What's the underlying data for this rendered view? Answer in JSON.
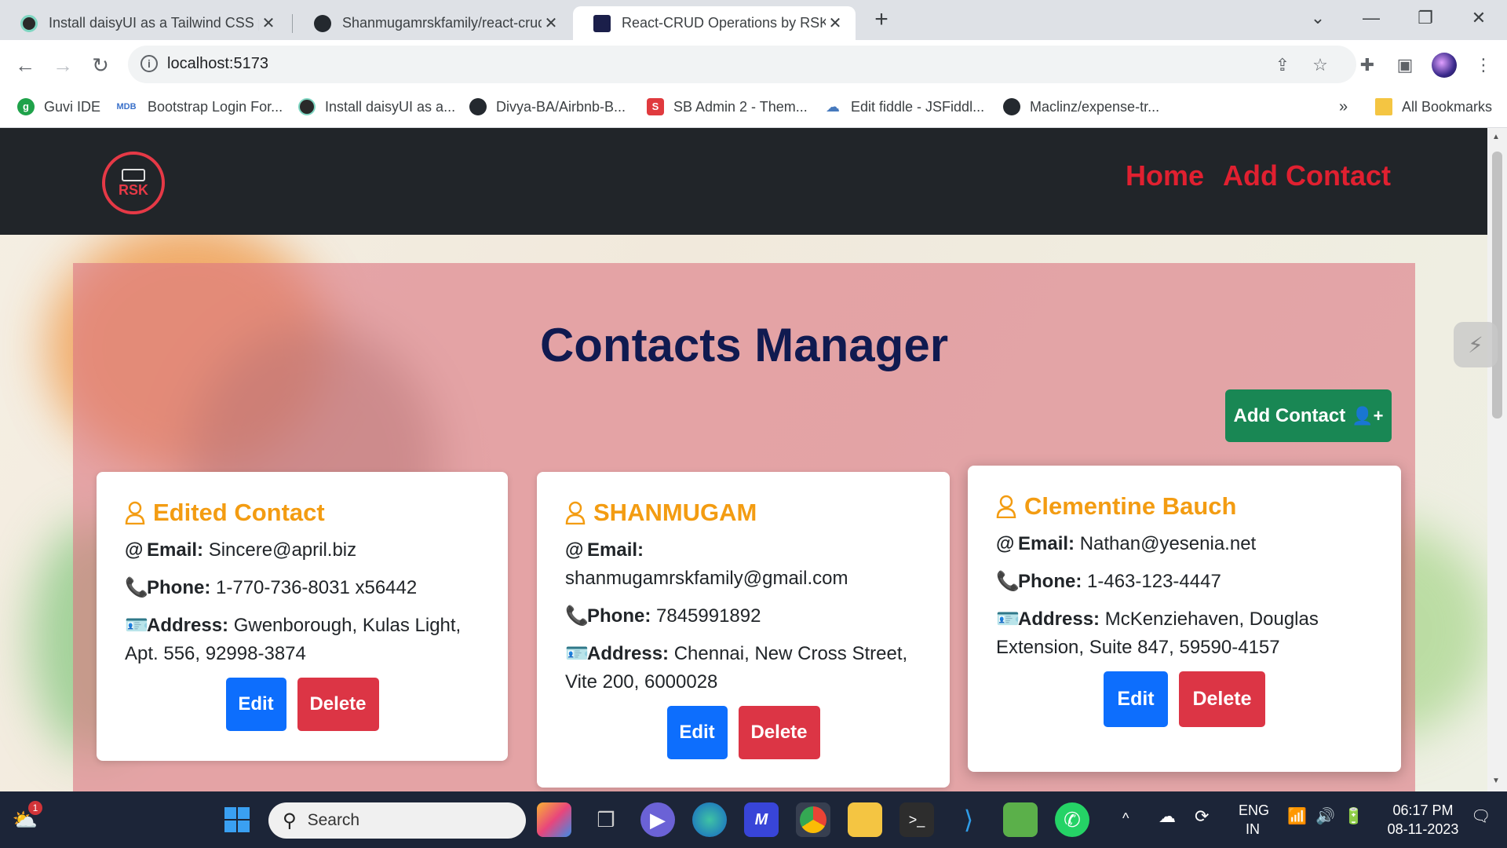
{
  "browser": {
    "tabs": [
      {
        "title": "Install daisyUI as a Tailwind CSS plugin",
        "favicon": "daisyui-icon",
        "active": false
      },
      {
        "title": "Shanmugamrskfamily/react-crud",
        "favicon": "github-icon",
        "active": false
      },
      {
        "title": "React-CRUD Operations by RSK",
        "favicon": "rsk-icon",
        "active": true
      }
    ],
    "url": "localhost:5173",
    "bookmarks": [
      {
        "label": "Guvi IDE",
        "icon": "guvi-icon"
      },
      {
        "label": "Bootstrap Login For...",
        "icon": "mdb-icon"
      },
      {
        "label": "Install daisyUI as a...",
        "icon": "daisyui-icon"
      },
      {
        "label": "Divya-BA/Airbnb-B...",
        "icon": "github-icon"
      },
      {
        "label": "SB Admin 2 - Them...",
        "icon": "sb-icon"
      },
      {
        "label": "Edit fiddle - JSFiddl...",
        "icon": "jsfiddle-icon"
      },
      {
        "label": "Maclinz/expense-tr...",
        "icon": "github-icon"
      }
    ],
    "more_bookmarks": "»",
    "all_bookmarks": "All Bookmarks"
  },
  "app": {
    "logo_text": "RSK",
    "nav": {
      "home": "Home",
      "add_contact": "Add Contact"
    },
    "heading": "Contacts Manager",
    "add_button": "Add Contact",
    "labels": {
      "email": "Email:",
      "phone": "Phone:",
      "address": "Address:"
    },
    "edit_label": "Edit",
    "delete_label": "Delete",
    "contacts": [
      {
        "name": "Edited Contact",
        "email": "Sincere@april.biz",
        "phone": "1-770-736-8031 x56442",
        "address": "Gwenborough, Kulas Light, Apt. 556, 92998-3874"
      },
      {
        "name": "SHANMUGAM",
        "email": "shanmugamrskfamily@gmail.com",
        "phone": "7845991892",
        "address": "Chennai, New Cross Street, Vite 200, 6000028"
      },
      {
        "name": "Clementine Bauch",
        "email": "Nathan@yesenia.net",
        "phone": "1-463-123-4447",
        "address": "McKenziehaven, Douglas Extension, Suite 847, 59590-4157"
      }
    ]
  },
  "taskbar": {
    "search_placeholder": "Search",
    "weather_badge": "1",
    "lang_line1": "ENG",
    "lang_line2": "IN",
    "time": "06:17 PM",
    "date": "08-11-2023"
  },
  "colors": {
    "navbar": "#212529",
    "nav_link": "#e02030",
    "heading": "#101a50",
    "contact_name": "#f39c12",
    "add_button": "#198754",
    "edit_button": "#0d6efd",
    "delete_button": "#dc3545"
  }
}
